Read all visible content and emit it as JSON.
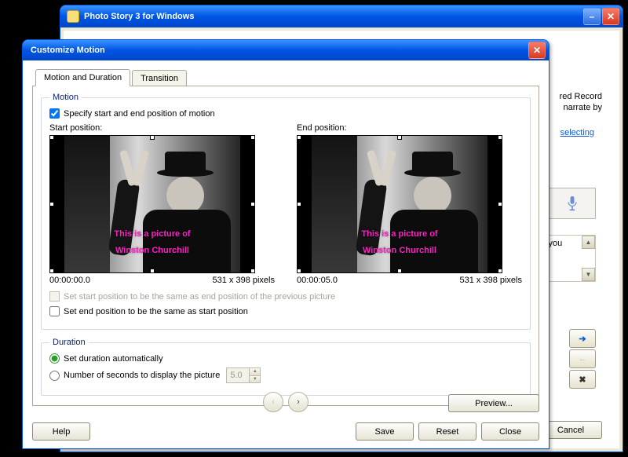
{
  "parent": {
    "title": "Photo Story 3 for Windows",
    "text_record": "red Record",
    "text_narrate": "narrate by",
    "link_selecting": "selecting",
    "text_syou": "s you",
    "buttons": {
      "cancel": "Cancel"
    },
    "arrow_icon": "➔",
    "x_icon": "✖"
  },
  "dialog": {
    "title": "Customize Motion",
    "tabs": {
      "motion": "Motion and Duration",
      "transition": "Transition"
    },
    "motion": {
      "legend": "Motion",
      "specify_label": "Specify start and end position of motion",
      "start_label": "Start position:",
      "end_label": "End position:",
      "overlay_line1": "This is a picture of",
      "overlay_line2": "Winston Churchill",
      "start_time": "00:00:00.0",
      "start_dims": "531 x 398 pixels",
      "end_time": "00:00:05.0",
      "end_dims": "531 x 398 pixels",
      "set_start_same_prev": "Set start position to be the same as end position of the previous picture",
      "set_end_same_start": "Set end position to be the same as start position"
    },
    "duration": {
      "legend": "Duration",
      "auto_label": "Set duration automatically",
      "seconds_label": "Number of seconds to display the picture",
      "seconds_value": "5.0"
    },
    "buttons": {
      "preview": "Preview...",
      "help": "Help",
      "save": "Save",
      "reset": "Reset",
      "close": "Close"
    }
  }
}
